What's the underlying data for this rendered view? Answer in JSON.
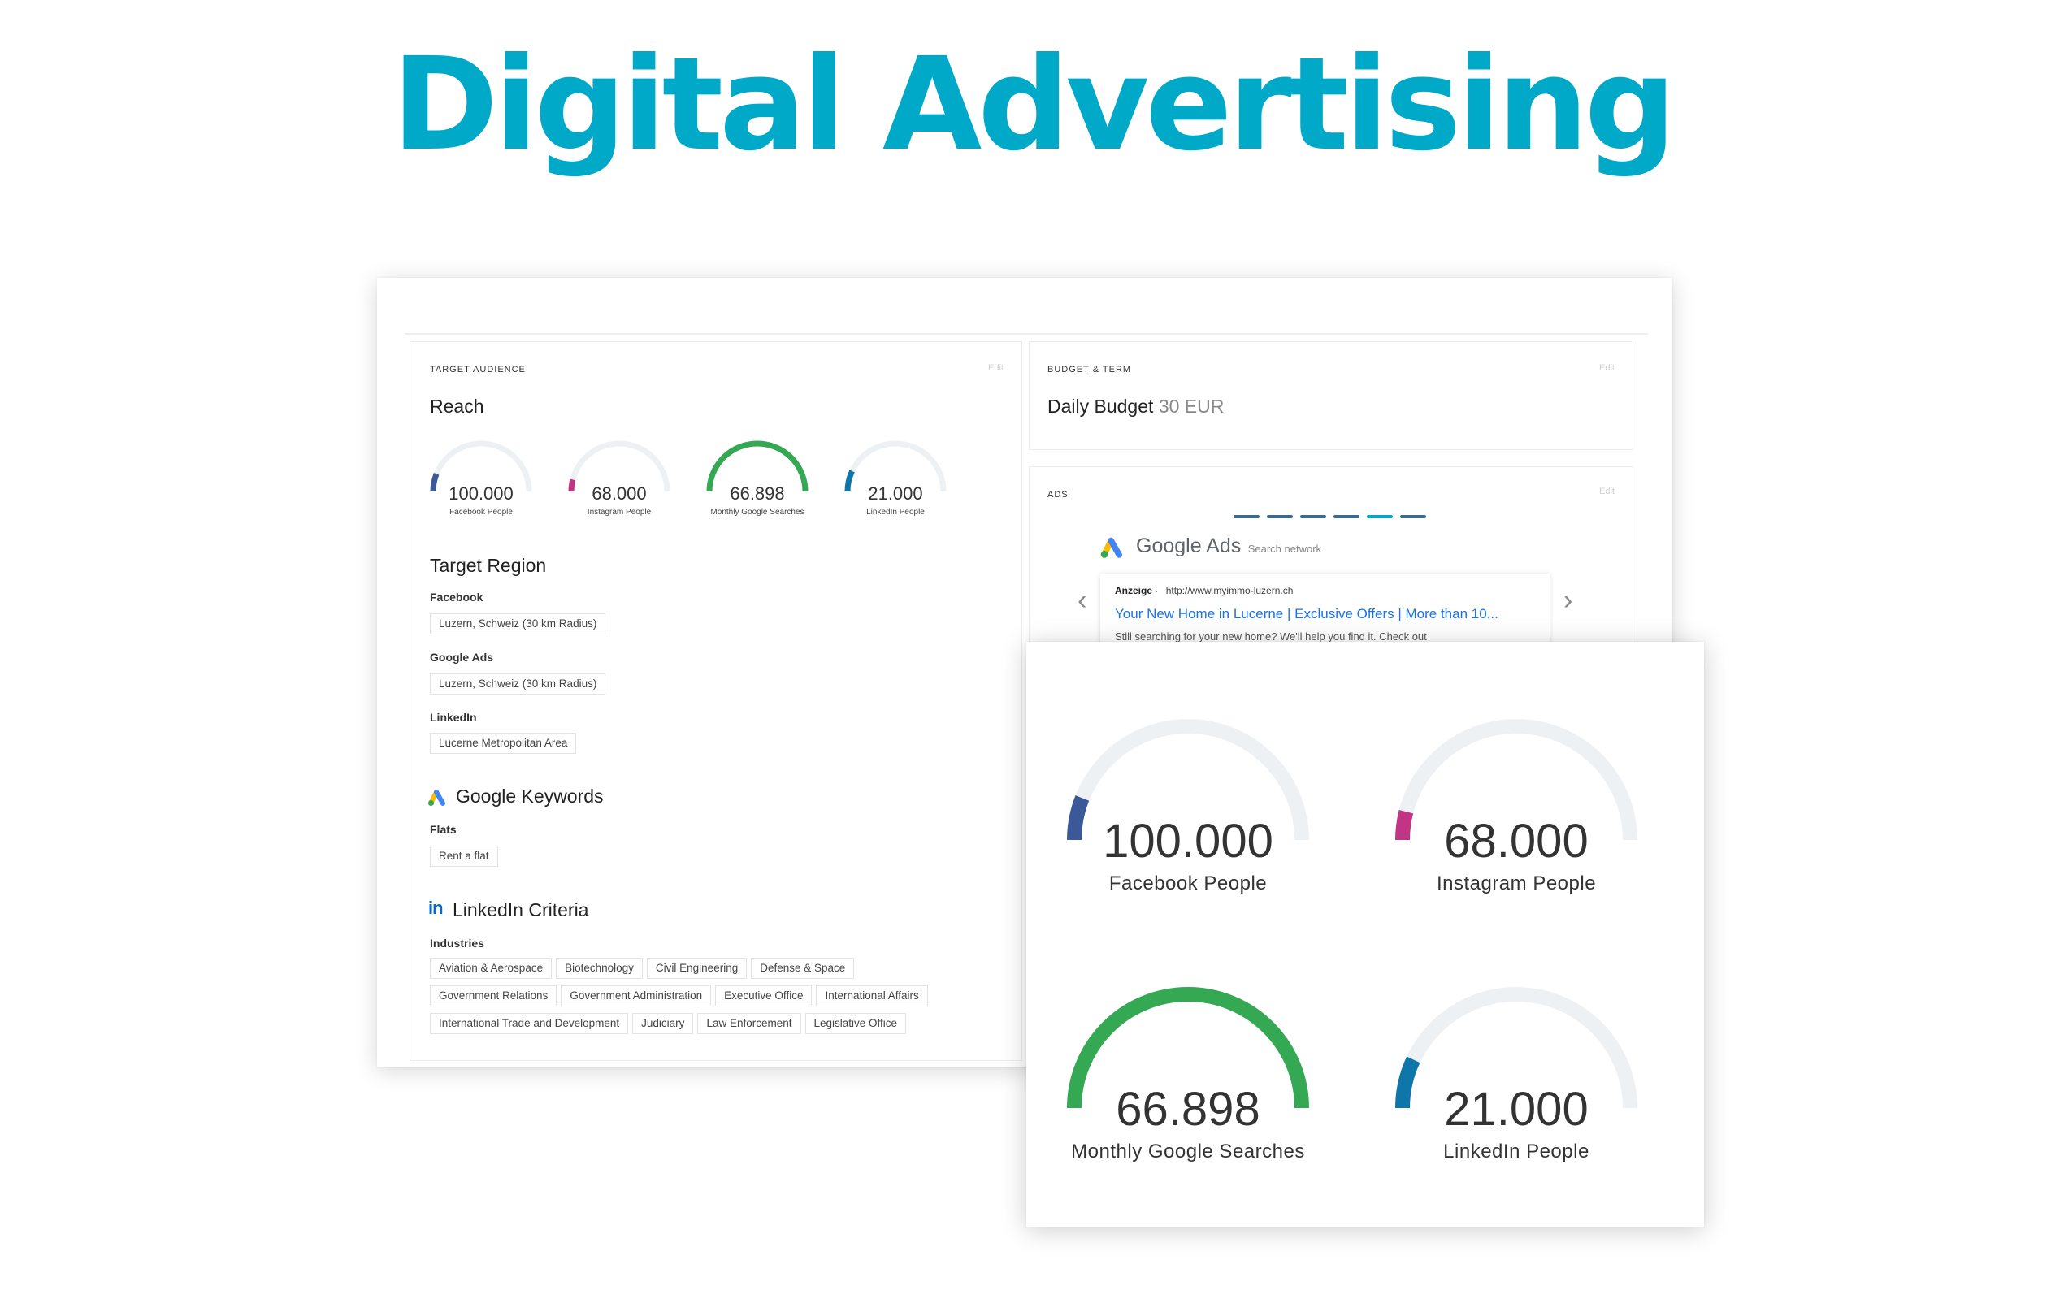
{
  "page": {
    "title": "Digital Advertising"
  },
  "target_audience": {
    "label": "TARGET AUDIENCE",
    "edit": "Edit",
    "reach_title": "Reach",
    "gauges": [
      {
        "value": "100.000",
        "caption": "Facebook People",
        "fraction": 0.12,
        "color": "#3b5998"
      },
      {
        "value": "68.000",
        "caption": "Instagram People",
        "fraction": 0.08,
        "color": "#c13584"
      },
      {
        "value": "66.898",
        "caption": "Monthly Google Searches",
        "fraction": 1.0,
        "color": "#34a853"
      },
      {
        "value": "21.000",
        "caption": "LinkedIn People",
        "fraction": 0.14,
        "color": "#0e76a8"
      }
    ],
    "region_title": "Target Region",
    "regions": [
      {
        "platform": "Facebook",
        "value": "Luzern, Schweiz (30 km Radius)"
      },
      {
        "platform": "Google Ads",
        "value": "Luzern, Schweiz (30 km Radius)"
      },
      {
        "platform": "LinkedIn",
        "value": "Lucerne Metropolitan Area"
      }
    ],
    "keywords_title": "Google Keywords",
    "keywords_group": "Flats",
    "keyword": "Rent a flat",
    "linkedin_title": "LinkedIn Criteria",
    "linkedin_icon": "in",
    "industries_label": "Industries",
    "industries_row1": [
      "Aviation & Aerospace",
      "Biotechnology",
      "Civil Engineering",
      "Defense & Space"
    ],
    "industries_row2": [
      "Government Relations",
      "Government Administration",
      "Executive Office",
      "International Affairs"
    ],
    "industries_row3": [
      "International Trade and Development",
      "Judiciary",
      "Law Enforcement",
      "Legislative Office"
    ]
  },
  "budget": {
    "label": "BUDGET & TERM",
    "edit": "Edit",
    "title": "Daily Budget",
    "amount": "30 EUR"
  },
  "ads": {
    "label": "ADS",
    "edit": "Edit",
    "brand": "Google Ads",
    "network": "Search network",
    "ad_tag": "Anzeige",
    "ad_sep": "·",
    "ad_url": "http://www.myimmo-luzern.ch",
    "ad_headline": "Your New Home in Lucerne | Exclusive Offers | More than 10...",
    "ad_description": "Still searching for your new home? We'll help you find it. Check out",
    "prev_icon": "‹",
    "next_icon": "›"
  },
  "overlay_gauges": [
    {
      "value": "100.000",
      "caption": "Facebook People",
      "fraction": 0.12,
      "color": "#3b5998"
    },
    {
      "value": "68.000",
      "caption": "Instagram People",
      "fraction": 0.08,
      "color": "#c13584"
    },
    {
      "value": "66.898",
      "caption": "Monthly Google Searches",
      "fraction": 1.0,
      "color": "#34a853"
    },
    {
      "value": "21.000",
      "caption": "LinkedIn People",
      "fraction": 0.14,
      "color": "#0e76a8"
    }
  ],
  "colors": {
    "title": "#00a9c7",
    "track": "#eef1f4",
    "link": "#1a0dab",
    "linkedin": "#0a66c2"
  }
}
